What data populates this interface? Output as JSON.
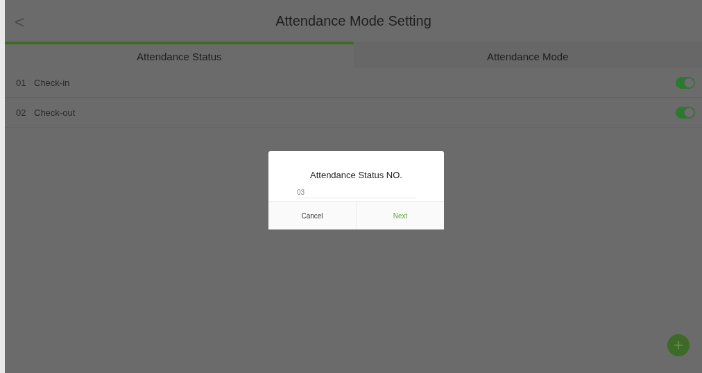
{
  "header": {
    "back": "<",
    "title": "Attendance Mode Setting"
  },
  "tabs": [
    {
      "label": "Attendance Status",
      "selected": true
    },
    {
      "label": "Attendance Mode",
      "selected": false
    }
  ],
  "statuses": [
    {
      "number": "01",
      "name": "Check-in",
      "on": true
    },
    {
      "number": "02",
      "name": "Check-out",
      "on": true
    }
  ],
  "dialog": {
    "title": "Attendance Status NO.",
    "value": "03",
    "buttons": [
      {
        "label": "Cancel",
        "kind": "cancel"
      },
      {
        "label": "Next",
        "kind": "primary"
      }
    ]
  }
}
